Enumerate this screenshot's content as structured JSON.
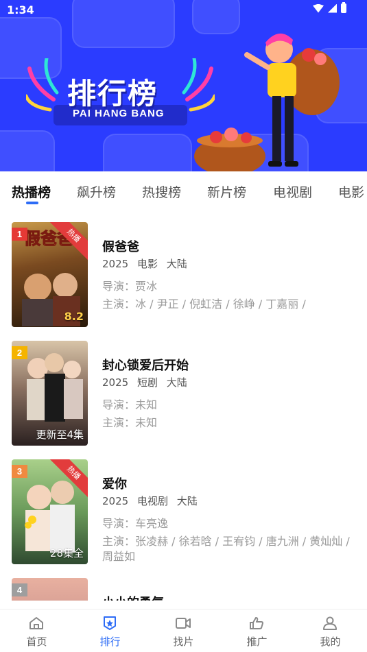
{
  "status_bar": {
    "time": "1:34"
  },
  "banner": {
    "title": "排行榜",
    "subtitle": "PAI HANG BANG"
  },
  "tabs": [
    {
      "label": "热播榜",
      "active": true
    },
    {
      "label": "飙升榜"
    },
    {
      "label": "热搜榜"
    },
    {
      "label": "新片榜"
    },
    {
      "label": "电视剧"
    },
    {
      "label": "电影"
    }
  ],
  "list": [
    {
      "rank": "1",
      "rank_color": "#e53935",
      "hot": true,
      "hot_label": "热播",
      "poster_colors": [
        "#8a5a2a",
        "#3a2410"
      ],
      "poster_caption": "8.2",
      "title": "假爸爸",
      "year": "2025",
      "type": "电影",
      "region": "大陆",
      "director": "导演：贾冰",
      "cast": "主演：冰 / 尹正 / 倪虹洁 / 徐峥 / 丁嘉丽 /"
    },
    {
      "rank": "2",
      "rank_color": "#f5b400",
      "hot": false,
      "poster_colors": [
        "#c9b59a",
        "#2a2020"
      ],
      "poster_caption": "更新至4集",
      "title": "封心锁爱后开始",
      "year": "2025",
      "type": "短剧",
      "region": "大陆",
      "director": "导演：未知",
      "cast": "主演：未知"
    },
    {
      "rank": "3",
      "rank_color": "#f08a40",
      "hot": true,
      "hot_label": "热播",
      "poster_colors": [
        "#7fb26a",
        "#2f5a3a"
      ],
      "poster_caption": "28集全",
      "title": "爱你",
      "year": "2025",
      "type": "电视剧",
      "region": "大陆",
      "director": "导演：车亮逸",
      "cast": "主演：张凌赫 / 徐若晗 / 王宥钧 / 唐九洲 / 黄灿灿 / 周益如"
    },
    {
      "rank": "4",
      "rank_color": "#9e9e9e",
      "hot": false,
      "poster_colors": [
        "#d8a090",
        "#9a6060"
      ],
      "poster_caption": "",
      "title": "小小的勇气",
      "year": "",
      "type": "",
      "region": "",
      "director": "",
      "cast": ""
    }
  ],
  "bottom_nav": [
    {
      "label": "首页",
      "icon": "home-icon"
    },
    {
      "label": "排行",
      "icon": "ranking-icon",
      "active": true
    },
    {
      "label": "找片",
      "icon": "video-icon"
    },
    {
      "label": "推广",
      "icon": "thumbs-up-icon"
    },
    {
      "label": "我的",
      "icon": "user-icon"
    }
  ],
  "colors": {
    "accent": "#2d6cf6",
    "banner_bg": "#2b3cff"
  }
}
